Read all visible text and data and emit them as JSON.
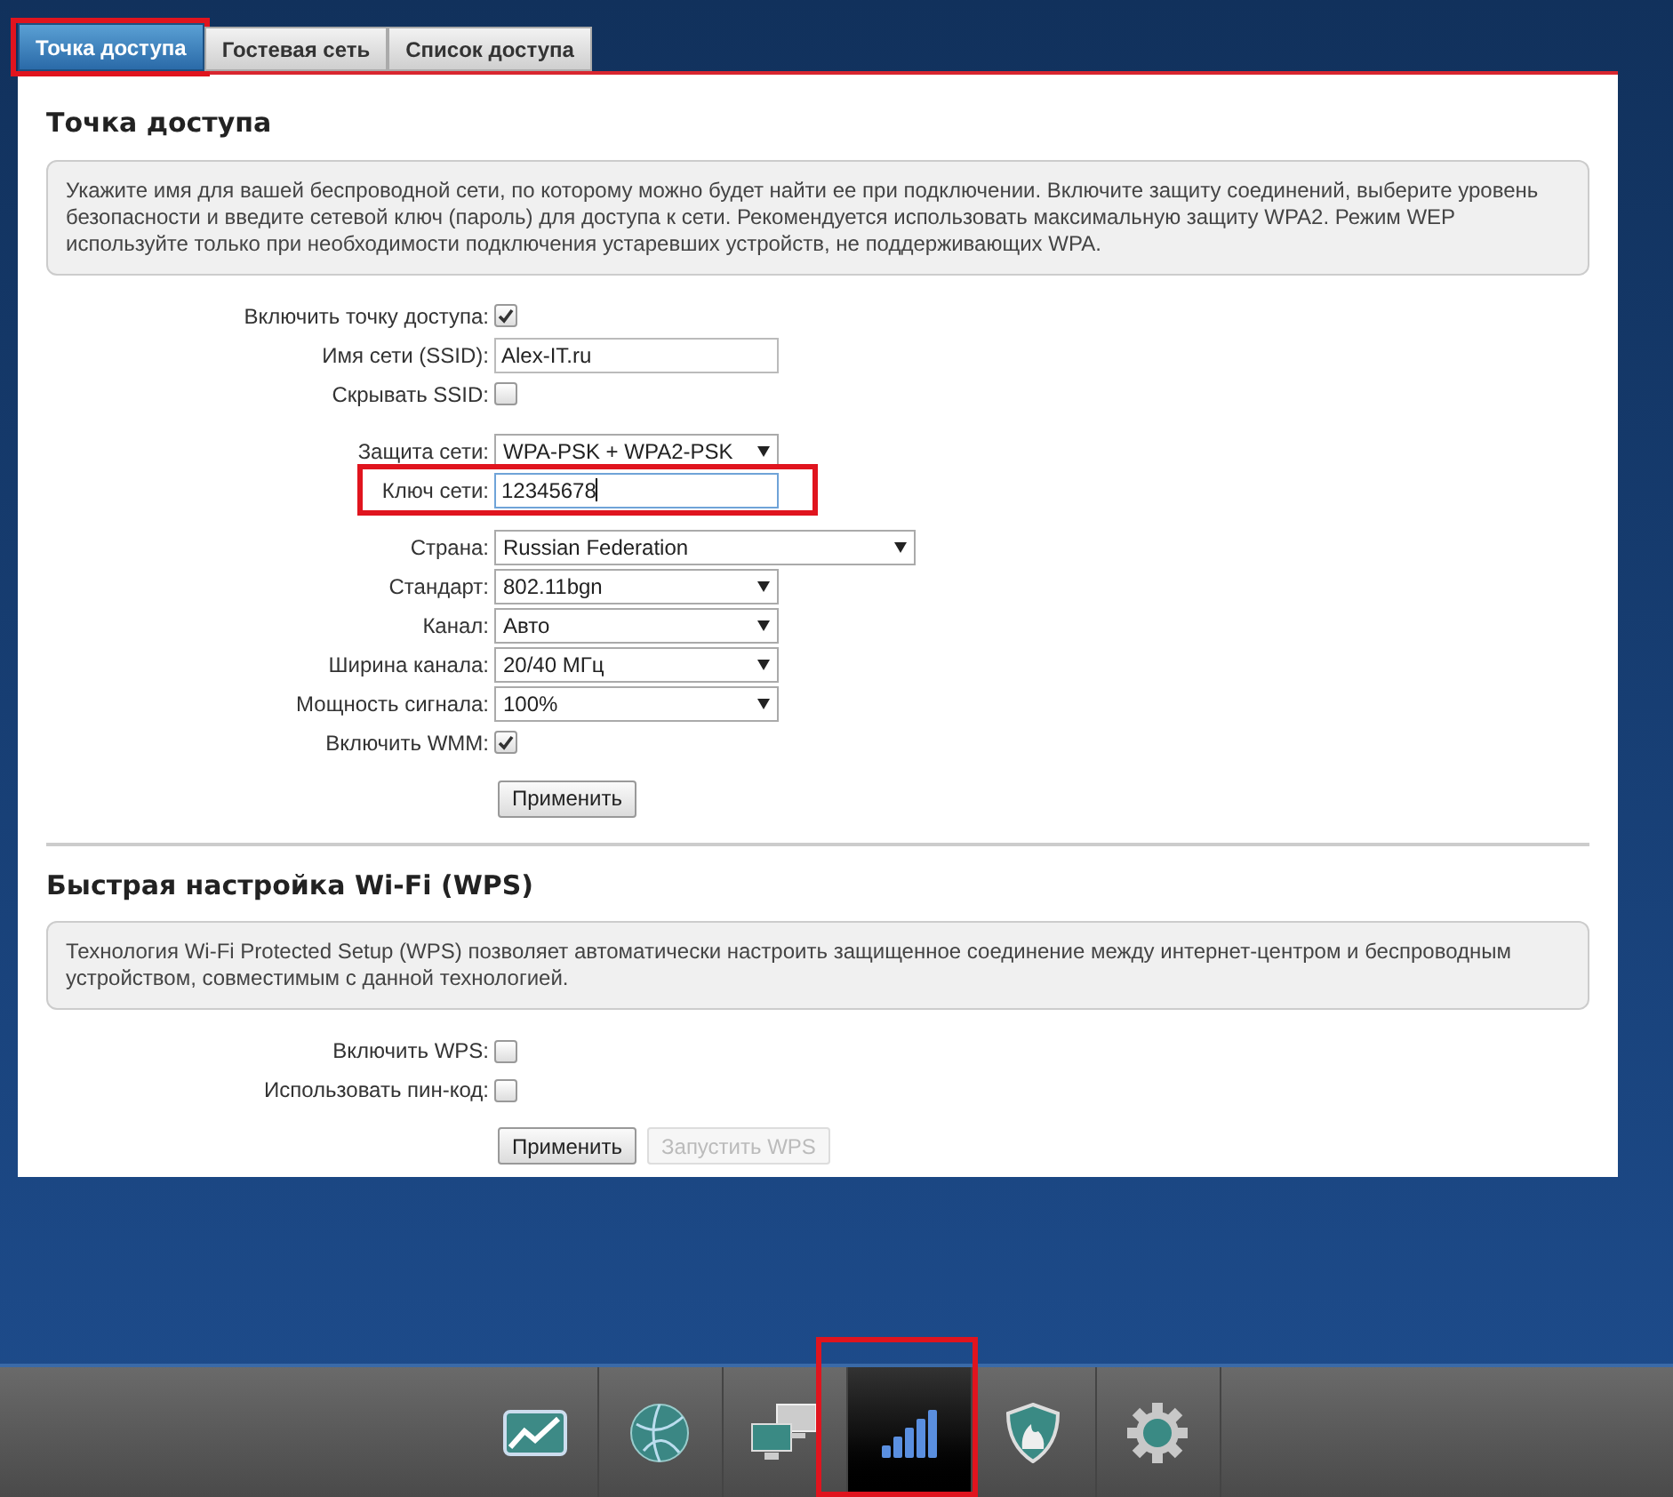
{
  "tabs": [
    {
      "label": "Точка доступа",
      "selected": true,
      "highlighted": true
    },
    {
      "label": "Гостевая сеть",
      "selected": false,
      "highlighted": false
    },
    {
      "label": "Список доступа",
      "selected": false,
      "highlighted": false
    }
  ],
  "sections": [
    {
      "title": "Точка доступа",
      "info": "Укажите имя для вашей беспроводной сети, по которому можно будет найти ее при подключении. Включите защиту соединений, выберите уровень безопасности и введите сетевой ключ (пароль) для доступа к сети. Рекомендуется использовать максимальную защиту WPA2. Режим WEP используйте только при необходимости подключения устаревших устройств, не поддерживающих WPA.",
      "field_groups": [
        [
          {
            "kind": "checkbox",
            "label": "Включить точку доступа:",
            "checked": true,
            "highlighted": false
          },
          {
            "kind": "text",
            "label": "Имя сети (SSID):",
            "value": "Alex-IT.ru",
            "highlighted": false,
            "focused": false
          },
          {
            "kind": "checkbox",
            "label": "Скрывать SSID:",
            "checked": false,
            "highlighted": false
          }
        ],
        [
          {
            "kind": "select",
            "label": "Защита сети:",
            "value": "WPA-PSK + WPA2-PSK",
            "highlighted": false,
            "wide": false
          },
          {
            "kind": "text",
            "label": "Ключ сети:",
            "value": "12345678",
            "highlighted": true,
            "focused": true
          }
        ],
        [
          {
            "kind": "select",
            "label": "Страна:",
            "value": "Russian Federation",
            "highlighted": false,
            "wide": true
          },
          {
            "kind": "select",
            "label": "Стандарт:",
            "value": "802.11bgn",
            "highlighted": false,
            "wide": false
          },
          {
            "kind": "select",
            "label": "Канал:",
            "value": "Авто",
            "highlighted": false,
            "wide": false
          },
          {
            "kind": "select",
            "label": "Ширина канала:",
            "value": "20/40 МГц",
            "highlighted": false,
            "wide": false
          },
          {
            "kind": "select",
            "label": "Мощность сигнала:",
            "value": "100%",
            "highlighted": false,
            "wide": false
          },
          {
            "kind": "checkbox",
            "label": "Включить WMM:",
            "checked": true,
            "highlighted": false
          }
        ]
      ],
      "buttons": [
        {
          "label": "Применить",
          "disabled": false
        }
      ]
    },
    {
      "title": "Быстрая настройка Wi-Fi (WPS)",
      "info": "Технология Wi-Fi Protected Setup (WPS) позволяет автоматически настроить защищенное соединение между интернет-центром и беспроводным устройством, совместимым с данной технологией.",
      "field_groups": [
        [
          {
            "kind": "checkbox",
            "label": "Включить WPS:",
            "checked": false,
            "highlighted": false
          },
          {
            "kind": "checkbox",
            "label": "Использовать пин-код:",
            "checked": false,
            "highlighted": false
          }
        ]
      ],
      "buttons": [
        {
          "label": "Применить",
          "disabled": false
        },
        {
          "label": "Запустить WPS",
          "disabled": true
        }
      ]
    }
  ],
  "dock": [
    {
      "kind": "chart",
      "selected": false,
      "highlighted": false
    },
    {
      "kind": "globe",
      "selected": false,
      "highlighted": false
    },
    {
      "kind": "computers",
      "selected": false,
      "highlighted": false
    },
    {
      "kind": "signal",
      "selected": true,
      "highlighted": true
    },
    {
      "kind": "shield",
      "selected": false,
      "highlighted": false
    },
    {
      "kind": "gear",
      "selected": false,
      "highlighted": false
    }
  ]
}
